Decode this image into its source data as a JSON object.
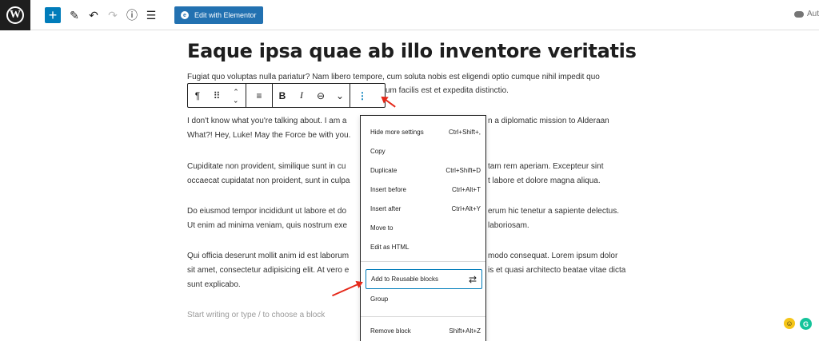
{
  "topbar": {
    "logo": "W",
    "add_label": "+",
    "tool_icon": "✎",
    "undo_icon": "↶",
    "redo_icon": "↷",
    "info_icon": "ⓘ",
    "list_icon": "☰",
    "elementor_icon": "e",
    "elementor_label": "Edit with Elementor",
    "autosave_label": "Aut"
  },
  "post": {
    "title": "Eaque ipsa quae ab illo inventore veritatis",
    "p1_line1": "Fugiat quo voluptas nulla pariatur? Nam libero tempore, cum soluta nobis est eligendi optio cumque nihil impedit quo",
    "p1_line2": "um facilis est et expedita distinctio.",
    "p2_line1a": "I don't know what you're talking about. I am a",
    "p2_line1b": "n a diplomatic mission to Alderaan",
    "p2_line2": "What?! Hey, Luke! May the Force be with you.",
    "p3_line1a": "Cupiditate non provident, similique sunt in cu",
    "p3_line1b": "tam rem aperiam. Excepteur sint",
    "p3_line2a": "occaecat cupidatat non proident, sunt in culpa",
    "p3_line2b": "t labore et dolore magna aliqua.",
    "p4_line1a": "Do eiusmod tempor incididunt ut labore et do",
    "p4_line1b": "erum hic tenetur a sapiente delectus.",
    "p4_line2a": "Ut enim ad minima veniam, quis nostrum exe",
    "p4_line2b": "laboriosam.",
    "p5_line1a": "Qui officia deserunt mollit anim id est laborum",
    "p5_line1b": "modo consequat. Lorem ipsum dolor",
    "p5_line2a": "sit amet, consectetur adipisicing elit. At vero e",
    "p5_line2b": "is et quasi architecto beatae vitae dicta",
    "p5_line3": "sunt explicabo.",
    "placeholder": "Start writing or type / to choose a block"
  },
  "block_toolbar": {
    "paragraph_icon": "¶",
    "drag_icon": "⠿",
    "move_icon": "⌃",
    "align_icon": "≡",
    "bold_label": "B",
    "italic_label": "I",
    "link_icon": "⊖",
    "more_icon": "⌄",
    "options_icon": "⋮"
  },
  "menu": {
    "items": [
      {
        "label": "Hide more settings",
        "shortcut": "Ctrl+Shift+,"
      },
      {
        "label": "Copy",
        "shortcut": ""
      },
      {
        "label": "Duplicate",
        "shortcut": "Ctrl+Shift+D"
      },
      {
        "label": "Insert before",
        "shortcut": "Ctrl+Alt+T"
      },
      {
        "label": "Insert after",
        "shortcut": "Ctrl+Alt+Y"
      },
      {
        "label": "Move to",
        "shortcut": ""
      },
      {
        "label": "Edit as HTML",
        "shortcut": ""
      }
    ],
    "reusable_label": "Add to Reusable blocks",
    "reusable_icon": "⇄",
    "group_label": "Group",
    "remove_label": "Remove block",
    "remove_shortcut": "Shift+Alt+Z"
  },
  "badges": {
    "emoji": "☺",
    "grammarly": "G"
  },
  "colors": {
    "accent": "#007cba",
    "elementor": "#2271b1",
    "annotation_arrow": "#e5291a",
    "grammarly": "#15c39a"
  }
}
